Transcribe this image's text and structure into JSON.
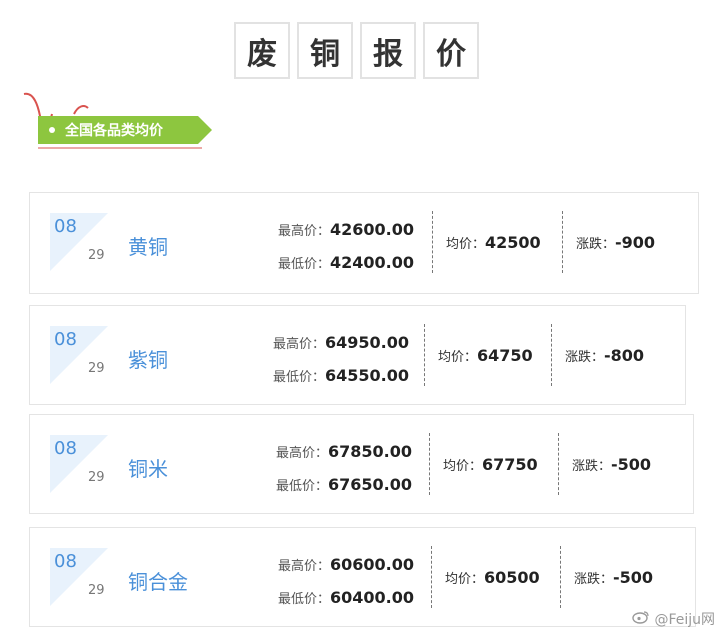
{
  "title_chars": [
    "废",
    "铜",
    "报",
    "价"
  ],
  "section_label": "全国各品类均价",
  "labels": {
    "high": "最高价：",
    "low": "最低价：",
    "avg": "均价：",
    "change": "涨跌："
  },
  "items": [
    {
      "month": "08",
      "day": "29",
      "name": "黄铜",
      "high": "42600.00",
      "low": "42400.00",
      "avg": "42500",
      "change": "-900"
    },
    {
      "month": "08",
      "day": "29",
      "name": "紫铜",
      "high": "64950.00",
      "low": "64550.00",
      "avg": "64750",
      "change": "-800"
    },
    {
      "month": "08",
      "day": "29",
      "name": "铜米",
      "high": "67850.00",
      "low": "67650.00",
      "avg": "67750",
      "change": "-500"
    },
    {
      "month": "08",
      "day": "29",
      "name": "铜合金",
      "high": "60600.00",
      "low": "60400.00",
      "avg": "60500",
      "change": "-500"
    }
  ],
  "colors": {
    "accent_blue": "#4a90d9",
    "ribbon_green": "#8dc63f",
    "ribbon_pink": "#d9534f"
  },
  "watermark": {
    "icon": "weibo-icon",
    "text": "@Feiju网"
  }
}
